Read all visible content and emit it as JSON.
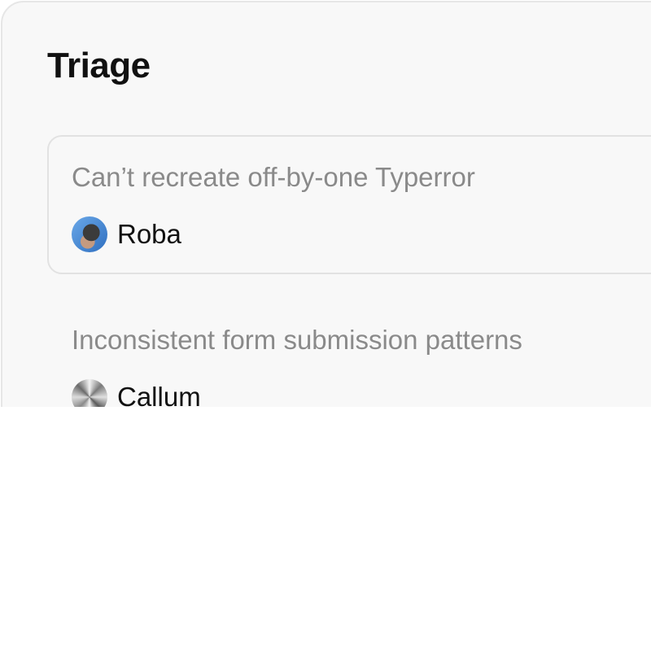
{
  "panel": {
    "title": "Triage",
    "issues": [
      {
        "title": "Can’t recreate off-by-one Typerror",
        "assignee": "Roba",
        "avatar_icon": "user-photo-avatar-icon",
        "selected": true
      },
      {
        "title": "Inconsistent form submission patterns",
        "assignee": "Callum",
        "avatar_icon": "metallic-avatar-icon",
        "selected": false
      }
    ]
  },
  "colors": {
    "panel_background": "#f8f8f8",
    "panel_border": "#e6e6e6",
    "issue_title_text": "#8a8a8a",
    "assignee_text": "#111111"
  }
}
